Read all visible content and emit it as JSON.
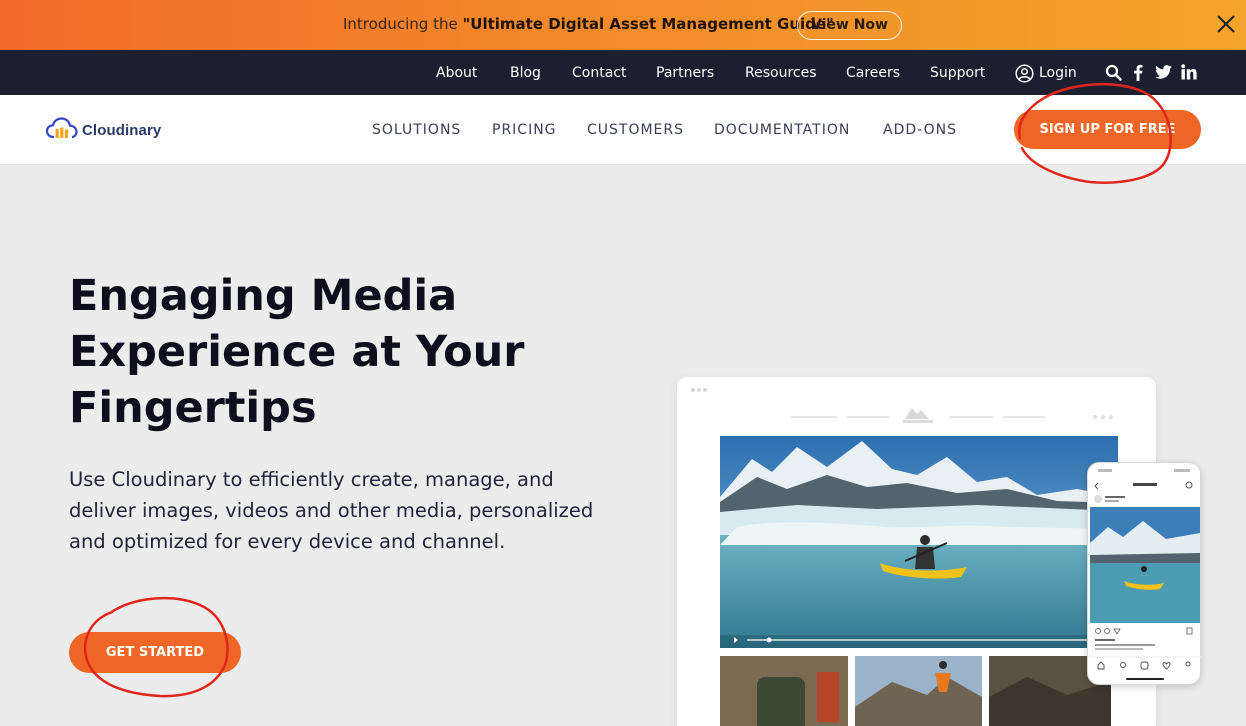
{
  "promo": {
    "prefix": "Introducing the ",
    "highlight": "\"Ultimate Digital Asset Management Guide\"",
    "button": "View Now"
  },
  "topnav": {
    "items": [
      "About",
      "Blog",
      "Contact",
      "Partners",
      "Resources",
      "Careers",
      "Support"
    ],
    "login": "Login",
    "icons": [
      "user-icon",
      "search-icon",
      "facebook-icon",
      "twitter-icon",
      "linkedin-icon"
    ]
  },
  "header": {
    "brand": "Cloudinary",
    "nav": [
      "SOLUTIONS",
      "PRICING",
      "CUSTOMERS",
      "DOCUMENTATION",
      "ADD-ONS"
    ],
    "signup": "SIGN UP FOR FREE"
  },
  "hero": {
    "headline": [
      "Engaging Media",
      "Experience at Your",
      "Fingertips"
    ],
    "description": "Use Cloudinary to efficiently create, manage, and deliver images, videos and other media, personalized and optimized for every device and channel.",
    "cta": "GET STARTED"
  },
  "colors": {
    "accent": "#f06626",
    "topnav_bg": "#1b1f30",
    "annotation": "#e0261a"
  }
}
